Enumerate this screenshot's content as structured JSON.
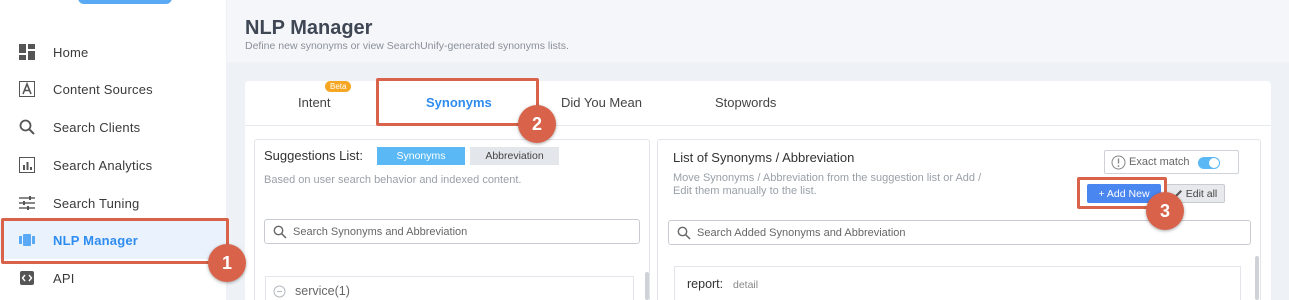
{
  "sidebar": {
    "items": [
      {
        "label": "Home",
        "icon": "dashboard-icon"
      },
      {
        "label": "Content Sources",
        "icon": "content-sources-icon"
      },
      {
        "label": "Search Clients",
        "icon": "search-icon"
      },
      {
        "label": "Search Analytics",
        "icon": "analytics-icon"
      },
      {
        "label": "Search Tuning",
        "icon": "tuning-icon"
      },
      {
        "label": "NLP Manager",
        "icon": "nlp-icon"
      },
      {
        "label": "API",
        "icon": "api-icon"
      }
    ]
  },
  "header": {
    "title": "NLP Manager",
    "subtitle": "Define new synonyms or view SearchUnify-generated synonyms lists."
  },
  "tabs": [
    {
      "label": "Intent",
      "badge": "Beta"
    },
    {
      "label": "Synonyms"
    },
    {
      "label": "Did You Mean"
    },
    {
      "label": "Stopwords"
    }
  ],
  "suggestions": {
    "title": "Suggestions List:",
    "toggle_on": "Synonyms",
    "toggle_off": "Abbreviation",
    "subtitle": "Based on user search behavior and indexed content.",
    "search_placeholder": "Search Synonyms and Abbreviation",
    "items": [
      "service(1)"
    ]
  },
  "synonym_list": {
    "title": "List of Synonyms / Abbreviation",
    "subtitle_line1": "Move Synonyms / Abbreviation from the suggestion list or Add /",
    "subtitle_line2": "Edit them manually to the list.",
    "exact_match_label": "Exact match",
    "add_new_label": "+ Add New",
    "edit_all_label": "Edit all",
    "search_placeholder": "Search Added Synonyms and Abbreviation",
    "entries": [
      {
        "term": "report:",
        "synonym": "detail"
      }
    ]
  },
  "annotations": [
    "1",
    "2",
    "3"
  ],
  "colors": {
    "accent": "#2e8cf0",
    "highlight": "#d9634a",
    "toggle": "#5ab8f5"
  }
}
